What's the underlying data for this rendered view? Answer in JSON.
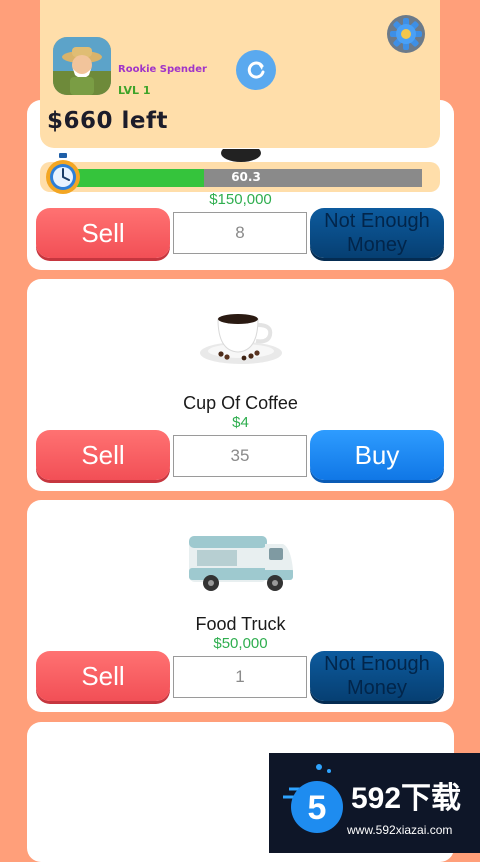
{
  "player": {
    "name": "Rookie Spender",
    "level": "LVL 1",
    "money_left": "$660 left"
  },
  "progress": {
    "value_text": "60.3",
    "fill_fraction": 0.38
  },
  "items": [
    {
      "name": "",
      "price": "$150,000",
      "quantity": "8",
      "sell_label": "Sell",
      "action_label": "Not Enough Money",
      "affordable": false
    },
    {
      "name": "Cup Of Coffee",
      "price": "$4",
      "quantity": "35",
      "sell_label": "Sell",
      "action_label": "Buy",
      "affordable": true
    },
    {
      "name": "Food Truck",
      "price": "$50,000",
      "quantity": "1",
      "sell_label": "Sell",
      "action_label": "Not Enough Money",
      "affordable": false
    }
  ],
  "watermark": {
    "brand": "592下载",
    "url": "www.592xiazai.com",
    "logo_digit": "5"
  },
  "colors": {
    "background": "#ff9f7a",
    "header": "#ffdeaa",
    "sell": "#f24f56",
    "buy": "#1077e6",
    "not_enough": "#063f72",
    "price": "#2fae4f",
    "progress_fill": "#35c43c"
  }
}
